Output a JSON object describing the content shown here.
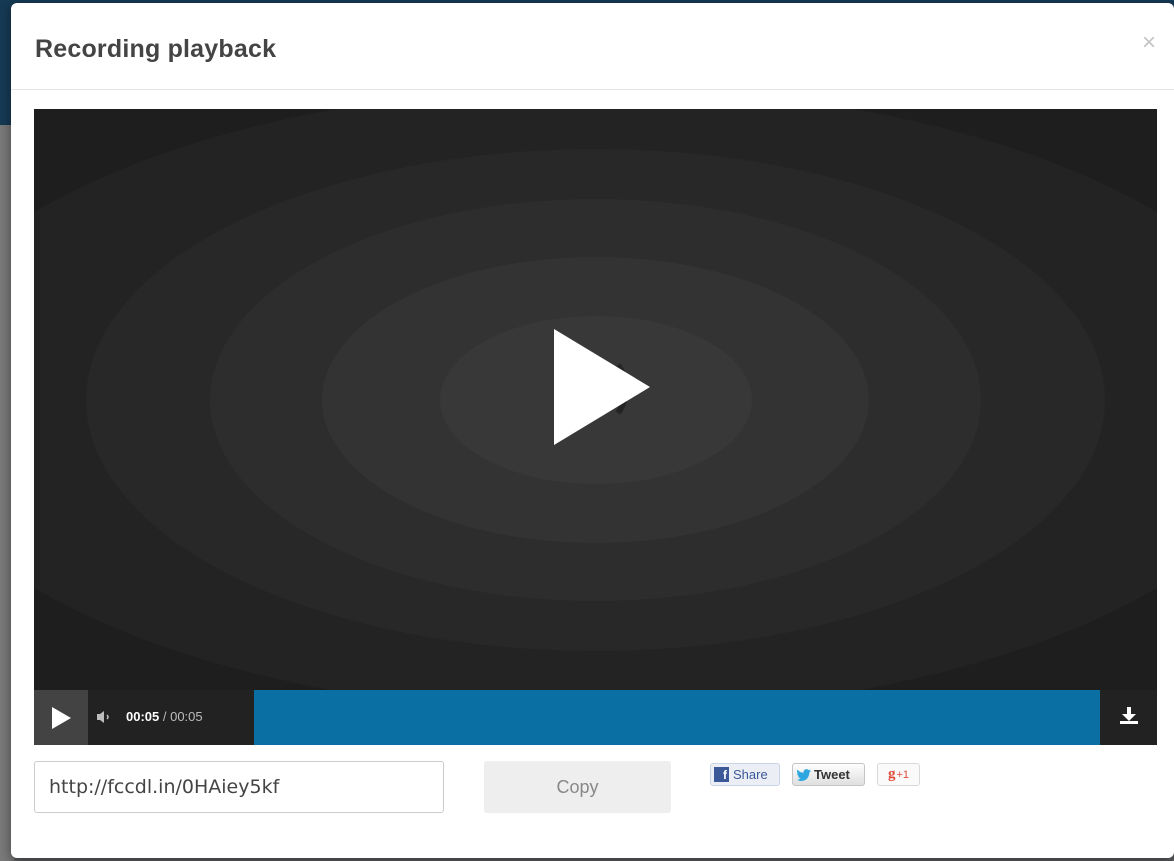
{
  "modal": {
    "title": "Recording playback",
    "close_label": "×"
  },
  "player": {
    "current_time": "00:05",
    "time_separator": " / ",
    "total_time": "00:05",
    "progress": 1.0,
    "accent_color": "#0a6fa3"
  },
  "share": {
    "url_value": "http://fccdl.in/0HAiey5kf",
    "copy_label": "Copy",
    "facebook_label": "Share",
    "facebook_icon": "f",
    "twitter_label": "Tweet",
    "gplus_g": "g",
    "gplus_label": "+1"
  },
  "icons": {
    "big_play": "play-icon",
    "play": "play-icon",
    "volume": "speaker-icon",
    "download": "download-icon",
    "close": "close-icon"
  }
}
